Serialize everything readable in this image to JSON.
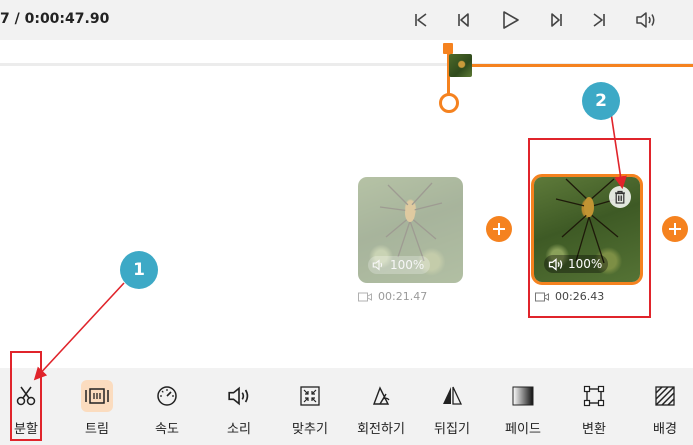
{
  "player": {
    "timecode": "7 / 0:00:47.90",
    "controls": [
      {
        "name": "skip-to-start",
        "label": ""
      },
      {
        "name": "previous-frame",
        "label": ""
      },
      {
        "name": "play",
        "label": ""
      },
      {
        "name": "next-frame",
        "label": ""
      },
      {
        "name": "skip-to-end",
        "label": ""
      },
      {
        "name": "volume",
        "label": ""
      }
    ]
  },
  "clips": [
    {
      "volume": "100%",
      "duration": "00:21.47",
      "state": "dimmed"
    },
    {
      "volume": "100%",
      "duration": "00:26.43",
      "state": "selected"
    }
  ],
  "annotations": {
    "badge1": "1",
    "badge2": "2"
  },
  "colors": {
    "accent": "#f5821f",
    "annotation_red": "#e0242b",
    "badge_blue": "#3da9c6",
    "toolbar_bg": "#f2f2f2"
  },
  "toolbar": {
    "items": [
      {
        "label": "분할",
        "icon": "scissors-icon"
      },
      {
        "label": "트림",
        "icon": "trim-icon",
        "active": true
      },
      {
        "label": "속도",
        "icon": "speedometer-icon"
      },
      {
        "label": "소리",
        "icon": "speaker-icon"
      },
      {
        "label": "맞추기",
        "icon": "fit-icon"
      },
      {
        "label": "회전하기",
        "icon": "rotate-icon"
      },
      {
        "label": "뒤집기",
        "icon": "flip-icon"
      },
      {
        "label": "페이드",
        "icon": "fade-icon"
      },
      {
        "label": "변환",
        "icon": "transform-icon"
      },
      {
        "label": "배경",
        "icon": "background-icon"
      }
    ]
  }
}
